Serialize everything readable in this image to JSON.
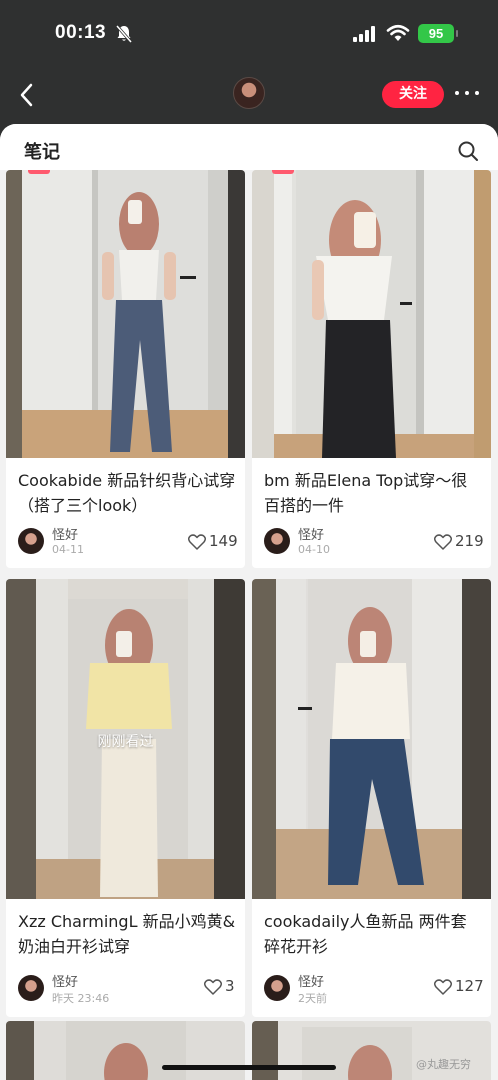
{
  "status_bar": {
    "time": "00:13",
    "battery": "95"
  },
  "nav": {
    "follow_label": "关注"
  },
  "section": {
    "title": "笔记"
  },
  "cards": [
    {
      "title": "Cookabide 新品针织背心试穿（搭了三个look）",
      "author": "怪好",
      "date": "04-11",
      "likes": "149"
    },
    {
      "title": "bm 新品Elena Top试穿～很百搭的一件",
      "author": "怪好",
      "date": "04-10",
      "likes": "219"
    },
    {
      "title": "Xzz CharmingL 新品小鸡黄&奶油白开衫试穿",
      "author": "怪好",
      "date": "昨天 23:46",
      "likes": "3",
      "overlay": "刚刚看过"
    },
    {
      "title": "cookadaily人鱼新品 两件套碎花开衫",
      "author": "怪好",
      "date": "2天前",
      "likes": "127"
    }
  ],
  "watermark": "@丸趣无穷",
  "colors": {
    "accent": "#ff2442",
    "battery": "#33c748"
  }
}
